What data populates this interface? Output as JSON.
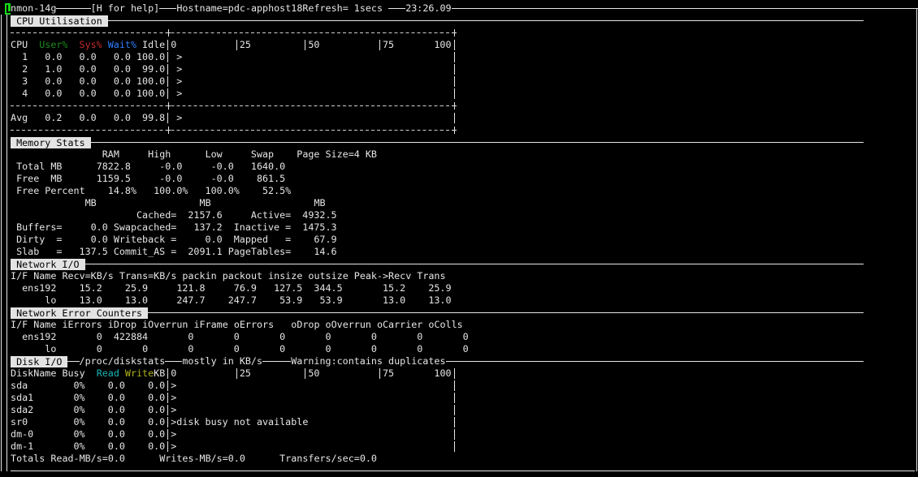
{
  "header": {
    "program": "nmon-14g",
    "help": "[H for help]",
    "hostname": "Hostname=pdc-apphost18",
    "refresh": "Refresh= 1secs",
    "time": "23:26.09"
  },
  "colors": {
    "cursor": "#16d916",
    "user": "#1f8a1f",
    "sys": "#c42a2a",
    "wait": "#2f7fff",
    "read": "#19b3b3",
    "write": "#b5b51c",
    "section_bg": "#e3e3e3"
  },
  "cpu": {
    "title": "CPU Utilisation",
    "columns": {
      "cpu": "CPU",
      "user": "User%",
      "sys": "Sys%",
      "wait": "Wait%",
      "idle": "Idle"
    },
    "scale": [
      "0",
      "25",
      "50",
      "75",
      "100"
    ],
    "rows": [
      {
        "cpu": "1",
        "user": "0.0",
        "sys": "0.0",
        "wait": "0.0",
        "idle": "100.0",
        "bar": " >"
      },
      {
        "cpu": "2",
        "user": "1.0",
        "sys": "0.0",
        "wait": "0.0",
        "idle": "99.0",
        "bar": " >"
      },
      {
        "cpu": "3",
        "user": "0.0",
        "sys": "0.0",
        "wait": "0.0",
        "idle": "100.0",
        "bar": " >"
      },
      {
        "cpu": "4",
        "user": "0.0",
        "sys": "0.0",
        "wait": "0.0",
        "idle": "100.0",
        "bar": " >"
      }
    ],
    "avg": {
      "cpu": "Avg",
      "user": "0.2",
      "sys": "0.0",
      "wait": "0.0",
      "idle": "99.8",
      "bar": " >"
    }
  },
  "memory": {
    "title": "Memory Stats",
    "columns": [
      "RAM",
      "High",
      "Low",
      "Swap"
    ],
    "page_size": "Page Size=4 KB",
    "total": {
      "label": "Total MB",
      "values": [
        "7822.8",
        "-0.0",
        "-0.0",
        "1640.0"
      ]
    },
    "free": {
      "label": "Free  MB",
      "values": [
        "1159.5",
        "-0.0",
        "-0.0",
        "861.5"
      ]
    },
    "free_percent": {
      "label": "Free Percent",
      "values": [
        "14.8%",
        "100.0%",
        "100.0%",
        "52.5%"
      ]
    },
    "units": [
      "MB",
      "MB",
      "MB"
    ],
    "details": [
      [
        {
          "label": "",
          "value": ""
        },
        {
          "label": "Cached=",
          "value": "2157.6"
        },
        {
          "label": "Active=",
          "value": "4932.5"
        }
      ],
      [
        {
          "label": "Buffers=",
          "value": "0.0"
        },
        {
          "label": "Swapcached=",
          "value": "137.2"
        },
        {
          "label": "Inactive =",
          "value": "1475.3"
        }
      ],
      [
        {
          "label": "Dirty  =",
          "value": "0.0"
        },
        {
          "label": "Writeback =",
          "value": "0.0"
        },
        {
          "label": "Mapped   =",
          "value": "67.9"
        }
      ],
      [
        {
          "label": "Slab   =",
          "value": "137.5"
        },
        {
          "label": "Commit_AS =",
          "value": "2091.1"
        },
        {
          "label": "PageTables=",
          "value": "14.6"
        }
      ]
    ]
  },
  "network": {
    "title": "Network I/O",
    "header": "I/F Name Recv=KB/s Trans=KB/s packin packout insize outsize Peak->Recv Trans",
    "rows": [
      {
        "name": "ens192",
        "values": [
          "15.2",
          "25.9",
          "121.8",
          "76.9",
          "127.5",
          "344.5",
          "15.2",
          "25.9"
        ]
      },
      {
        "name": "lo",
        "values": [
          "13.0",
          "13.0",
          "247.7",
          "247.7",
          "53.9",
          "53.9",
          "13.0",
          "13.0"
        ]
      }
    ]
  },
  "network_errors": {
    "title": "Network Error Counters",
    "header": "I/F Name iErrors iDrop iOverrun iFrame oErrors   oDrop oOverrun oCarrier oColls",
    "rows": [
      {
        "name": "ens192",
        "values": [
          "0",
          "422884",
          "0",
          "0",
          "0",
          "0",
          "0",
          "0",
          "0"
        ]
      },
      {
        "name": "lo",
        "values": [
          "0",
          "0",
          "0",
          "0",
          "0",
          "0",
          "0",
          "0",
          "0"
        ]
      }
    ]
  },
  "disk": {
    "title": "Disk I/O",
    "source": "/proc/diskstats",
    "units_note": "mostly in KB/s",
    "warning": "Warning:contains duplicates",
    "columns": {
      "name": "DiskName",
      "busy": "Busy",
      "read": "Read",
      "write": "Write",
      "kb": "KB"
    },
    "scale": [
      "0",
      "25",
      "50",
      "75",
      "100"
    ],
    "rows": [
      {
        "name": "sda",
        "busy": "0%",
        "read": "0.0",
        "write": "0.0",
        "bar": ">"
      },
      {
        "name": "sda1",
        "busy": "0%",
        "read": "0.0",
        "write": "0.0",
        "bar": ">"
      },
      {
        "name": "sda2",
        "busy": "0%",
        "read": "0.0",
        "write": "0.0",
        "bar": ">"
      },
      {
        "name": "sr0",
        "busy": "0%",
        "read": "0.0",
        "write": "0.0",
        "bar": ">disk busy not available"
      },
      {
        "name": "dm-0",
        "busy": "0%",
        "read": "0.0",
        "write": "0.0",
        "bar": ">"
      },
      {
        "name": "dm-1",
        "busy": "0%",
        "read": "0.0",
        "write": "0.0",
        "bar": ">"
      }
    ],
    "totals": {
      "read_label": "Totals Read-MB/s=",
      "read": "0.0",
      "write_label": "Writes-MB/s=",
      "write": "0.0",
      "transfers_label": "Transfers/sec=",
      "transfers": "0.0"
    }
  }
}
